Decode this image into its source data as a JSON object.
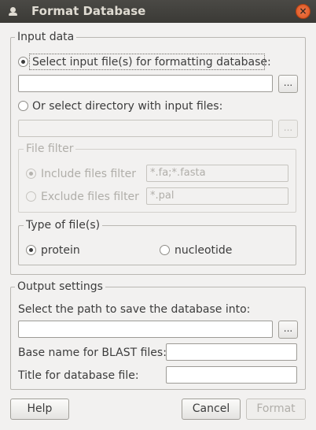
{
  "window": {
    "title": "Format Database",
    "close_glyph": "×"
  },
  "input_data": {
    "group_title": "Input data",
    "select_files_label": "Select input file(s) for formatting database:",
    "file_path_value": "",
    "browse_label": "...",
    "select_directory_label": "Or select directory with input files:",
    "directory_value": "",
    "directory_browse_label": "...",
    "file_filter": {
      "group_title": "File filter",
      "include_label": "Include files filter",
      "include_value": "*.fa;*.fasta",
      "exclude_label": "Exclude files filter",
      "exclude_value": "*.pal"
    },
    "type_of_files": {
      "group_title": "Type of file(s)",
      "protein_label": "protein",
      "nucleotide_label": "nucleotide",
      "selected": "protein"
    },
    "selected_source": "files"
  },
  "output_settings": {
    "group_title": "Output settings",
    "path_label": "Select the path to save the database into:",
    "path_value": "",
    "browse_label": "...",
    "base_name_label": "Base name for BLAST files:",
    "base_name_value": "",
    "title_label": "Title for database file:",
    "title_value": ""
  },
  "buttons": {
    "help": "Help",
    "cancel": "Cancel",
    "format": "Format"
  }
}
